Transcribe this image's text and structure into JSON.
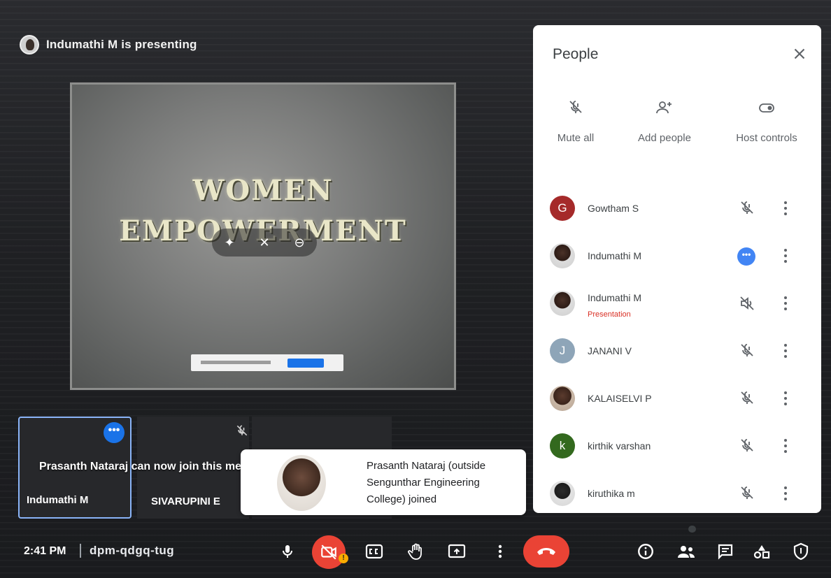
{
  "presenter": {
    "text": "Indumathi M is presenting"
  },
  "slide": {
    "title_line1": "WOMEN",
    "title_line2": "EMPOWERMENT"
  },
  "tiles": [
    {
      "name": "Indumathi M"
    },
    {
      "name": "SIVARUPINI E"
    }
  ],
  "toast": {
    "text": "Prasanth Nataraj can now join this meeting"
  },
  "notification": {
    "text": "Prasanth Nataraj (outside Sengunthar Engineering College) joined"
  },
  "people_panel": {
    "title": "People",
    "actions": {
      "mute_all": "Mute all",
      "add_people": "Add people",
      "host_controls": "Host controls"
    },
    "participants": [
      {
        "name": "Gowtham S",
        "initial": "G",
        "color": "#a52a2a",
        "sub": ""
      },
      {
        "name": "Indumathi M",
        "initial": "",
        "color": "",
        "sub": ""
      },
      {
        "name": "Indumathi M",
        "initial": "",
        "color": "",
        "sub": "Presentation"
      },
      {
        "name": "JANANI V",
        "initial": "J",
        "color": "#8ea5b8",
        "sub": ""
      },
      {
        "name": "KALAISELVI P",
        "initial": "",
        "color": "",
        "sub": ""
      },
      {
        "name": "kirthik varshan",
        "initial": "k",
        "color": "#33691e",
        "sub": ""
      },
      {
        "name": "kiruthika m",
        "initial": "",
        "color": "",
        "sub": ""
      }
    ]
  },
  "bottom_bar": {
    "time": "2:41 PM",
    "meeting_code": "dpm-qdgq-tug",
    "camera_alert": "!"
  },
  "colors": {
    "danger": "#ea4335",
    "accent": "#1a73e8",
    "panel_bg": "#ffffff"
  }
}
